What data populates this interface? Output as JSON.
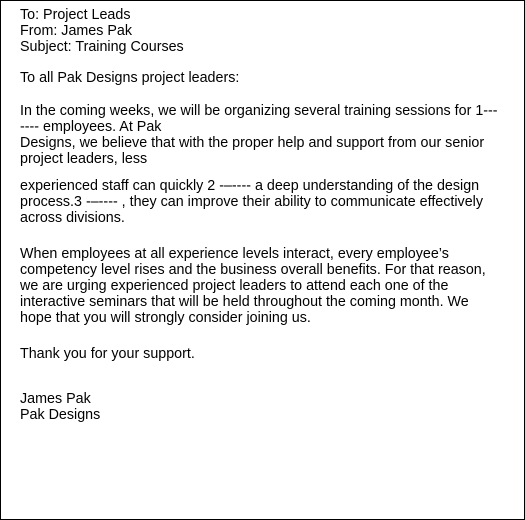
{
  "memo": {
    "to_line": "To: Project Leads",
    "from_line": "From: James Pak",
    "subject_line": "Subject: Training Courses",
    "greeting": "To all Pak Designs project leaders:",
    "paragraph1_lines": [
      "In the coming weeks, we will be organizing several training sessions for 1---",
      "---- employees. At Pak",
      "Designs, we believe that with the proper help and support from our senior",
      "project leaders, less"
    ],
    "paragraph2_lines": [
      "experienced staff can quickly 2 -–---- a deep understanding of the design",
      "process.3 -–---- , they can improve their ability to communicate effectively",
      "across divisions."
    ],
    "paragraph3_lines": [
      "When employees at all experience levels interact, every employee’s",
      "competency level rises and the business overall benefits. For that reason,",
      "we are urging experienced project leaders to attend each one of the",
      "interactive seminars that will be held throughout the coming month. We",
      "hope that you will strongly consider joining us."
    ],
    "closing": "Thank you for your support.",
    "signature_name": "James Pak",
    "signature_company": "Pak Designs"
  }
}
